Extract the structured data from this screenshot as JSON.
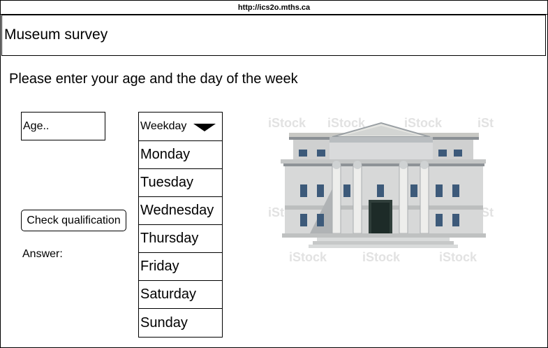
{
  "browser": {
    "url": "http://ics2o.mths.ca"
  },
  "header": {
    "title": "Museum survey"
  },
  "main": {
    "prompt": "Please enter your age and the day of the week",
    "age_input": {
      "placeholder": "Age..",
      "value": ""
    },
    "check_button_label": "Check qualification",
    "answer_label": "Answer:",
    "day_select": {
      "header_label": "Weekday",
      "options": [
        "Monday",
        "Tuesday",
        "Wednesday",
        "Thursday",
        "Friday",
        "Saturday",
        "Sunday"
      ]
    },
    "image": {
      "icon": "museum-building-icon"
    }
  }
}
